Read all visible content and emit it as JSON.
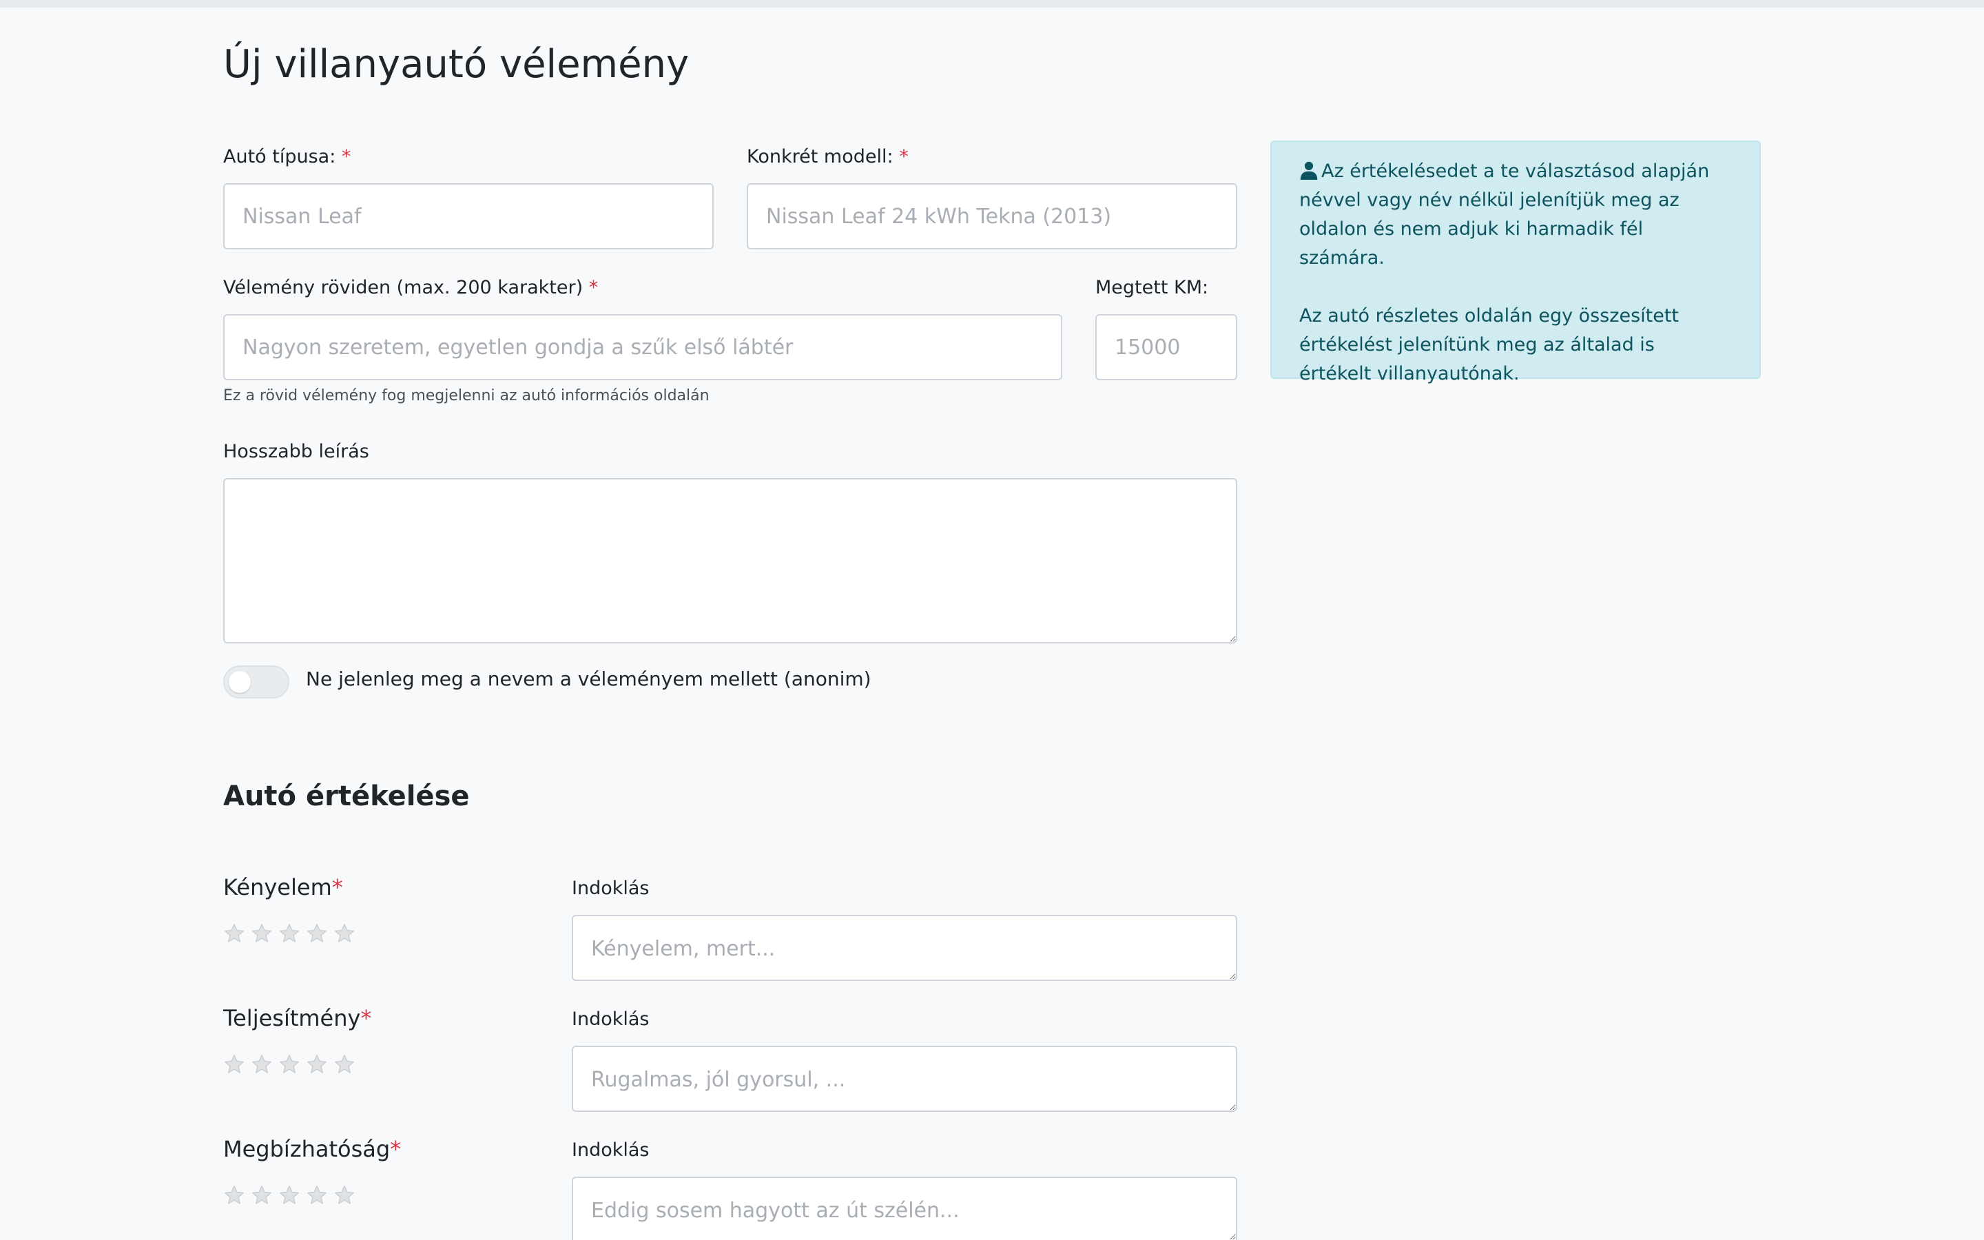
{
  "page": {
    "title": "Új villanyautó vélemény"
  },
  "form": {
    "required_marker": "*",
    "car_type": {
      "label": "Autó típusa:",
      "placeholder": "Nissan Leaf",
      "value": ""
    },
    "model": {
      "label": "Konkrét modell:",
      "placeholder": "Nissan Leaf 24 kWh Tekna (2013)",
      "value": ""
    },
    "short_review": {
      "label": "Vélemény röviden (max. 200 karakter)",
      "placeholder": "Nagyon szeretem, egyetlen gondja a szűk első lábtér",
      "value": "",
      "help": "Ez a rövid vélemény fog megjelenni az autó információs oldalán"
    },
    "km": {
      "label": "Megtett KM:",
      "placeholder": "15000",
      "value": ""
    },
    "long_description": {
      "label": "Hosszabb leírás",
      "value": ""
    },
    "anonymous": {
      "label": "Ne jelenleg meg a nevem a véleményem mellett (anonim)",
      "checked": false
    }
  },
  "info": {
    "icon": "user-icon",
    "paragraph1": "Az értékelésedet a te választásod alapján névvel vagy név nélkül jelenítjük meg az oldalon és nem adjuk ki harmadik fél számára.",
    "paragraph2": "Az autó részletes oldalán egy összesített értékelést jelenítünk meg az általad is értékelt villanyautónak."
  },
  "rating": {
    "section_title": "Autó értékelése",
    "categories": [
      {
        "label": "Kényelem",
        "rating": 0,
        "max": 5,
        "reason_label": "Indoklás",
        "reason_placeholder": "Kényelem, mert..."
      },
      {
        "label": "Teljesítmény",
        "rating": 0,
        "max": 5,
        "reason_label": "Indoklás",
        "reason_placeholder": "Rugalmas, jól gyorsul, ..."
      },
      {
        "label": "Megbízhatóság",
        "rating": 0,
        "max": 5,
        "reason_label": "Indoklás",
        "reason_placeholder": "Eddig sosem hagyott az út szélén..."
      }
    ]
  },
  "colors": {
    "background": "#f8f9fa",
    "required": "#dc3545",
    "info_bg": "#d1ecf1",
    "info_text": "#0c5460",
    "star_empty": "#dfe1e2"
  }
}
